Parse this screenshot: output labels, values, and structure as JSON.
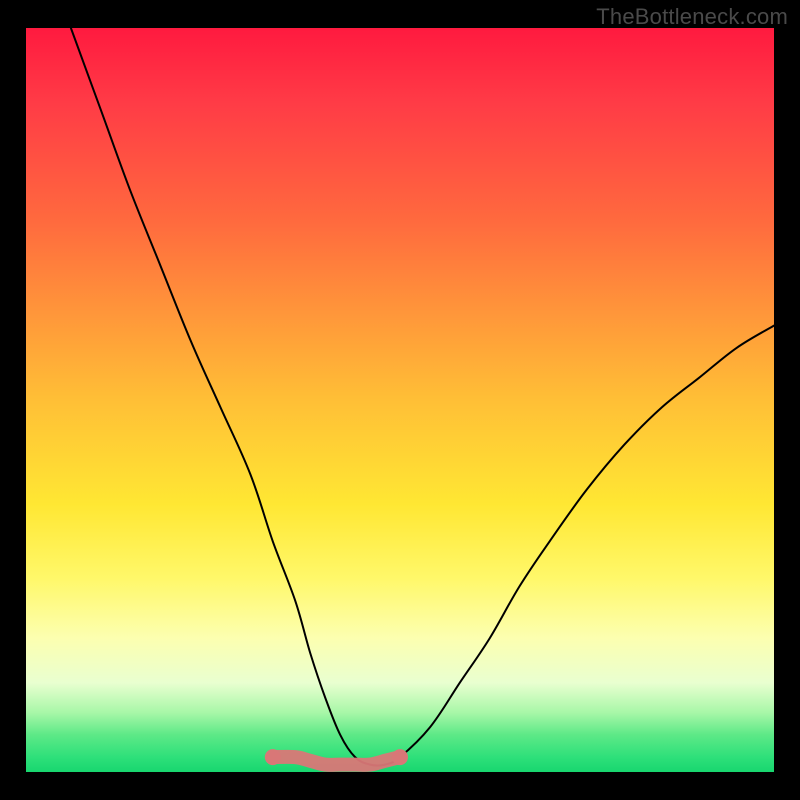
{
  "watermark": "TheBottleneck.com",
  "chart_data": {
    "type": "line",
    "title": "",
    "xlabel": "",
    "ylabel": "",
    "xlim": [
      0,
      100
    ],
    "ylim": [
      0,
      100
    ],
    "grid": false,
    "legend": false,
    "series": [
      {
        "name": "main-curve",
        "color": "#000000",
        "x": [
          6,
          10,
          14,
          18,
          22,
          26,
          30,
          33,
          36,
          38,
          40,
          42,
          44,
          46,
          48,
          50,
          54,
          58,
          62,
          66,
          70,
          75,
          80,
          85,
          90,
          95,
          100
        ],
        "y": [
          100,
          89,
          78,
          68,
          58,
          49,
          40,
          31,
          23,
          16,
          10,
          5,
          2,
          1,
          1,
          2,
          6,
          12,
          18,
          25,
          31,
          38,
          44,
          49,
          53,
          57,
          60
        ]
      },
      {
        "name": "flat-bottom-highlight",
        "color": "#d97777",
        "x": [
          33,
          36,
          38,
          40,
          42,
          44,
          46,
          48,
          50
        ],
        "y": [
          2,
          2,
          1.5,
          1,
          1,
          1,
          1,
          1.5,
          2
        ]
      }
    ],
    "gradient_stops": [
      {
        "pct": 0,
        "color": "#ff1a3f"
      },
      {
        "pct": 26,
        "color": "#ff6a3e"
      },
      {
        "pct": 50,
        "color": "#ffbf36"
      },
      {
        "pct": 74,
        "color": "#fff86a"
      },
      {
        "pct": 88,
        "color": "#e9ffd0"
      },
      {
        "pct": 100,
        "color": "#18d66f"
      }
    ]
  }
}
